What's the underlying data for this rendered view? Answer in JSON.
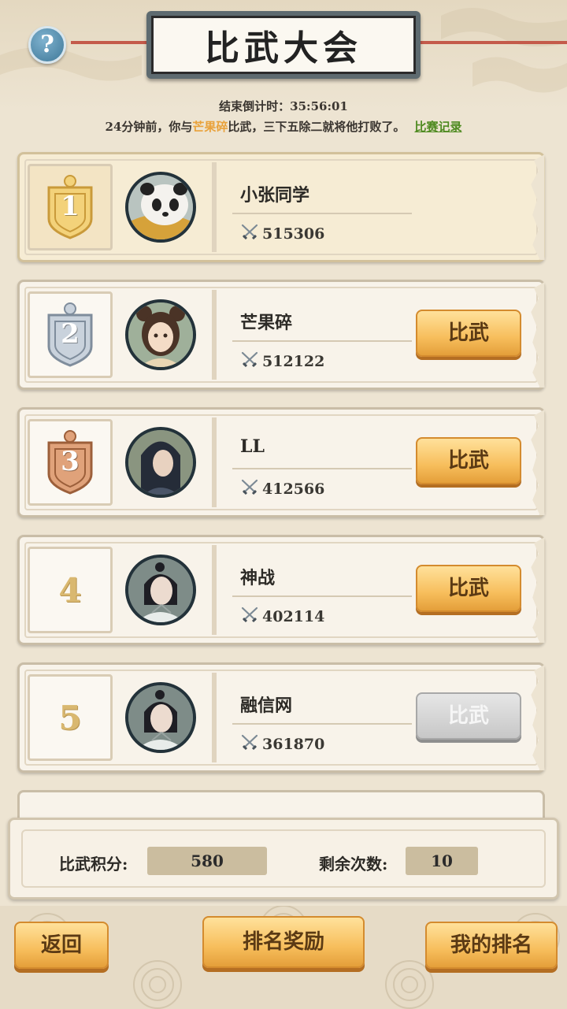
{
  "header": {
    "title": "比武大会",
    "help_label": "?"
  },
  "countdown": {
    "label": "结束倒计时：",
    "value": "35:56:01"
  },
  "news": {
    "prefix": "24分钟前，你与",
    "opponent": "芒果碎",
    "suffix": "比武，三下五除二就将他打败了。",
    "link": "比赛记录"
  },
  "ranking": [
    {
      "rank": "1",
      "name": "小张同学",
      "power": "515306",
      "button": "",
      "button_state": "none",
      "avatar": "panda-avatar"
    },
    {
      "rank": "2",
      "name": "芒果碎",
      "power": "512122",
      "button": "比武",
      "button_state": "active",
      "avatar": "girl-avatar"
    },
    {
      "rank": "3",
      "name": "LL",
      "power": "412566",
      "button": "比武",
      "button_state": "active",
      "avatar": "swordsman-avatar"
    },
    {
      "rank": "4",
      "name": "神战",
      "power": "402114",
      "button": "比武",
      "button_state": "active",
      "avatar": "scholar-avatar"
    },
    {
      "rank": "5",
      "name": "融信网",
      "power": "361870",
      "button": "比武",
      "button_state": "disabled",
      "avatar": "scholar-avatar"
    }
  ],
  "stats": {
    "score_label": "比武积分:",
    "score_value": "580",
    "remaining_label": "剩余次数:",
    "remaining_value": "10"
  },
  "footer": {
    "back": "返回",
    "rewards": "排名奖励",
    "my_rank": "我的排名"
  },
  "colors": {
    "accent_orange": "#f7be5c",
    "highlight": "#e9a23b",
    "link_green": "#4e8a20",
    "gold": "#d9b870",
    "silver": "#a9b4c0",
    "bronze": "#c98a62"
  }
}
